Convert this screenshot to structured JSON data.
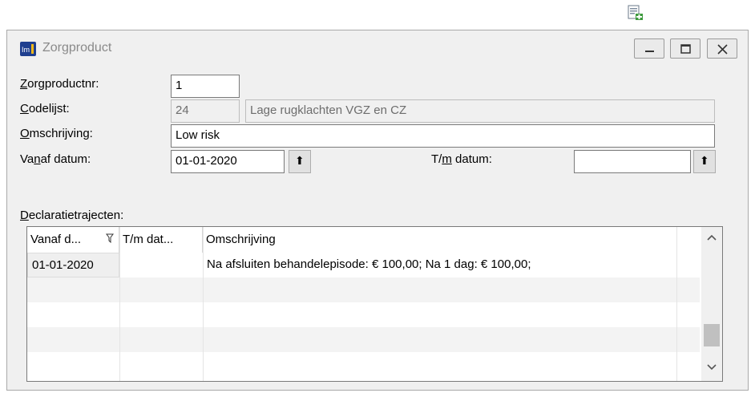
{
  "window": {
    "title": "Zorgproduct",
    "controls": {
      "minimize": "minimize",
      "maximize": "maximize",
      "close": "close"
    }
  },
  "form": {
    "zorgproductnr": {
      "label_u": "Z",
      "label_rest": "orgproductnr:",
      "value": "1"
    },
    "codelijst": {
      "label_u": "C",
      "label_rest": "odelijst:",
      "code": "24",
      "description": "Lage rugklachten VGZ en CZ"
    },
    "omschrijving": {
      "label_u": "O",
      "label_rest": "mschrijving:",
      "value": "Low risk"
    },
    "vanaf_datum": {
      "label_pre": "Va",
      "label_u": "n",
      "label_rest": "af datum:",
      "value": "01-01-2020"
    },
    "tm_datum": {
      "label_pre": "T/",
      "label_u": "m",
      "label_rest": " datum:",
      "value": ""
    }
  },
  "declaraties": {
    "label_u": "D",
    "label_rest": "eclaratietrajecten:",
    "columns": [
      "Vanaf d...",
      "T/m dat...",
      "Omschrijving"
    ],
    "filter_icon": "filter-icon",
    "rows": [
      {
        "vanaf": "01-01-2020",
        "tm": "",
        "omschrijving": "Na afsluiten behandelepisode: € 100,00; Na 1 dag: € 100,00;"
      }
    ]
  },
  "colors": {
    "window_bg": "#f0f0f0",
    "border": "#7a7a7a",
    "readonly_text": "#6d6d6d"
  }
}
